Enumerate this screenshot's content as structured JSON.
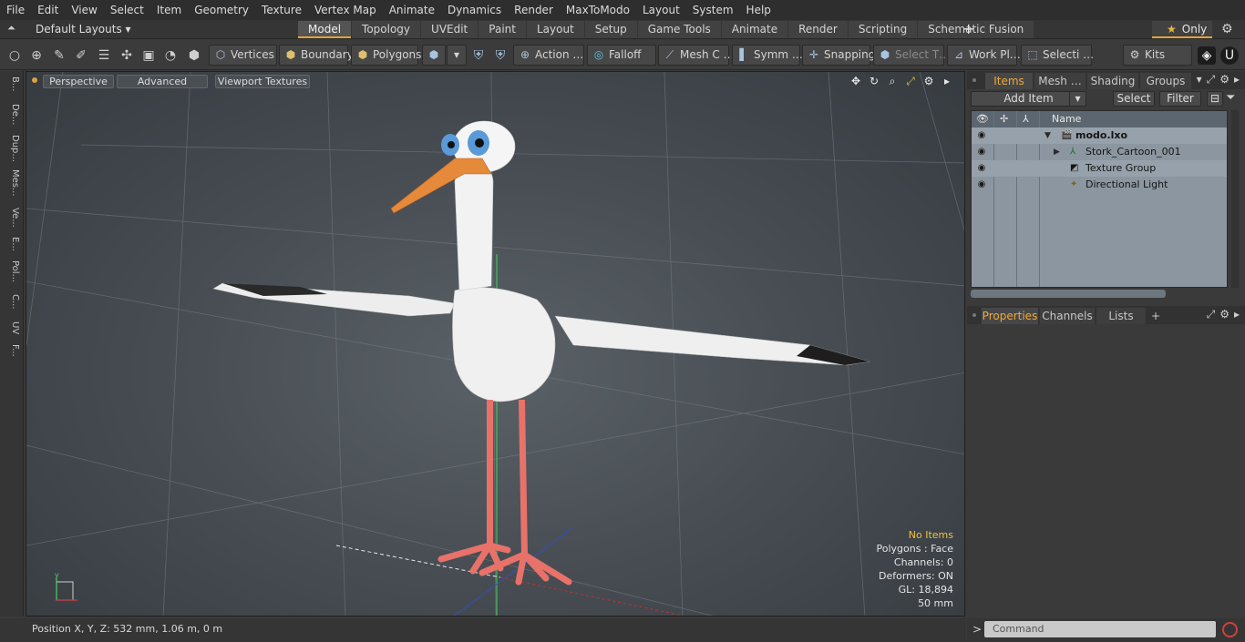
{
  "menu": [
    "File",
    "Edit",
    "View",
    "Select",
    "Item",
    "Geometry",
    "Texture",
    "Vertex Map",
    "Animate",
    "Dynamics",
    "Render",
    "MaxToModo",
    "Layout",
    "System",
    "Help"
  ],
  "layoutbar": {
    "layout_name": "Default Layouts ▾",
    "tabs": [
      "Model",
      "Topology",
      "UVEdit",
      "Paint",
      "Layout",
      "Setup",
      "Game Tools",
      "Animate",
      "Render",
      "Scripting",
      "Schematic Fusion"
    ],
    "active_tab": "Model",
    "plus": "+",
    "only_label": "Only"
  },
  "toolbar": {
    "vertices": "Vertices",
    "boundary": "Boundary",
    "polygons": "Polygons",
    "action": "Action …",
    "falloff": "Falloff",
    "mesh": "Mesh C …",
    "symm": "Symm …",
    "snapping": "Snapping",
    "select_t": "Select T…",
    "work_pl": "Work Pl…",
    "selecti": "Selecti …",
    "kits": "Kits"
  },
  "leftstrip": [
    "B...",
    "De...",
    "Dup...",
    "Mes...",
    "Ve...",
    "E...",
    "Pol...",
    "C...",
    "UV",
    "F..."
  ],
  "viewport": {
    "perspective": "Perspective",
    "advanced": "Advanced",
    "viewport_textures": "Viewport Textures",
    "info": {
      "no_items": "No Items",
      "polygons": "Polygons : Face",
      "channels": "Channels: 0",
      "deformers": "Deformers: ON",
      "gl": "GL: 18,894",
      "mm": "50 mm"
    }
  },
  "status": {
    "position": "Position X, Y, Z:   532 mm, 1.06 m, 0 m"
  },
  "items_panel": {
    "tabs": [
      "Items",
      "Mesh …",
      "Shading",
      "Groups"
    ],
    "active_tab": "Items",
    "add_item": "Add Item",
    "select": "Select",
    "filter": "Filter",
    "column_name": "Name",
    "tree": [
      {
        "label": "modo.lxo",
        "depth": 0,
        "icon": "scene-icon"
      },
      {
        "label": "Stork_Cartoon_001",
        "depth": 1,
        "icon": "locator-icon"
      },
      {
        "label": "Texture Group",
        "depth": 1,
        "icon": "texture-group-icon"
      },
      {
        "label": "Directional Light",
        "depth": 1,
        "icon": "light-icon"
      }
    ]
  },
  "props_panel": {
    "tabs": [
      "Properties",
      "Channels",
      "Lists"
    ],
    "active_tab": "Properties",
    "plus": "+"
  },
  "command": {
    "placeholder": "Command",
    "prompt": ">"
  }
}
